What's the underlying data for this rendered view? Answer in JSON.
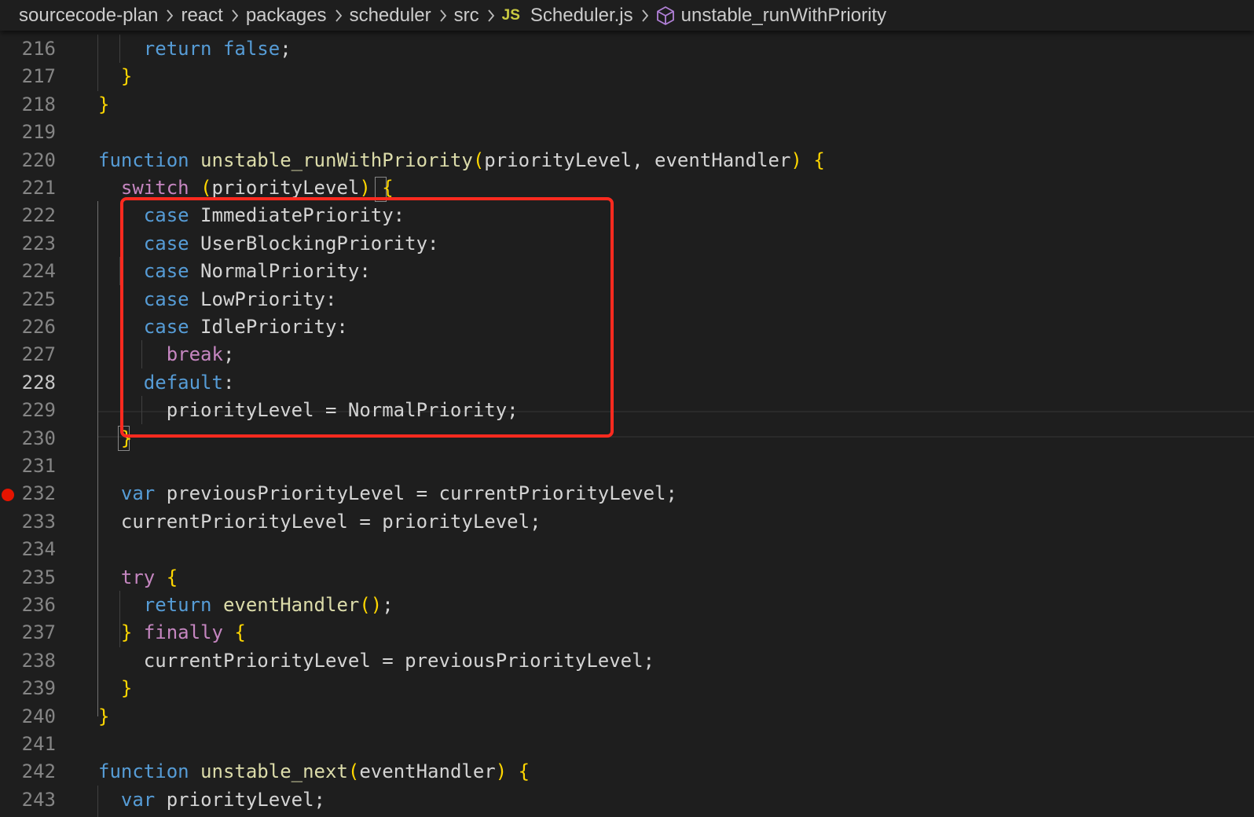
{
  "breadcrumb": {
    "items": [
      "sourcecode-plan",
      "react",
      "packages",
      "scheduler",
      "src"
    ],
    "file_badge": "JS",
    "file_name": "Scheduler.js",
    "symbol": "unstable_runWithPriority",
    "symbol_icon": "cube-icon"
  },
  "editor": {
    "active_line": "228",
    "breakpoint_line": "232",
    "lines": [
      {
        "n": "216",
        "code": "    return false;"
      },
      {
        "n": "217",
        "code": "  }"
      },
      {
        "n": "218",
        "code": "}"
      },
      {
        "n": "219",
        "code": ""
      },
      {
        "n": "220",
        "code": "function unstable_runWithPriority(priorityLevel, eventHandler) {"
      },
      {
        "n": "221",
        "code": "  switch (priorityLevel) {"
      },
      {
        "n": "222",
        "code": "    case ImmediatePriority:"
      },
      {
        "n": "223",
        "code": "    case UserBlockingPriority:"
      },
      {
        "n": "224",
        "code": "    case NormalPriority:"
      },
      {
        "n": "225",
        "code": "    case LowPriority:"
      },
      {
        "n": "226",
        "code": "    case IdlePriority:"
      },
      {
        "n": "227",
        "code": "      break;"
      },
      {
        "n": "228",
        "code": "    default:"
      },
      {
        "n": "229",
        "code": "      priorityLevel = NormalPriority;"
      },
      {
        "n": "230",
        "code": "  }"
      },
      {
        "n": "231",
        "code": ""
      },
      {
        "n": "232",
        "code": "  var previousPriorityLevel = currentPriorityLevel;"
      },
      {
        "n": "233",
        "code": "  currentPriorityLevel = priorityLevel;"
      },
      {
        "n": "234",
        "code": ""
      },
      {
        "n": "235",
        "code": "  try {"
      },
      {
        "n": "236",
        "code": "    return eventHandler();"
      },
      {
        "n": "237",
        "code": "  } finally {"
      },
      {
        "n": "238",
        "code": "    currentPriorityLevel = previousPriorityLevel;"
      },
      {
        "n": "239",
        "code": "  }"
      },
      {
        "n": "240",
        "code": "}"
      },
      {
        "n": "241",
        "code": ""
      },
      {
        "n": "242",
        "code": "function unstable_next(eventHandler) {"
      },
      {
        "n": "243",
        "code": "  var priorityLevel;"
      }
    ]
  },
  "colors": {
    "background": "#1e1e1e",
    "keyword": "#569cd6",
    "control": "#c586c0",
    "function": "#dcdcaa",
    "text": "#d4d4d4",
    "line_number": "#858585",
    "breakpoint": "#e51400",
    "annotation_box": "#ff2a1f"
  }
}
